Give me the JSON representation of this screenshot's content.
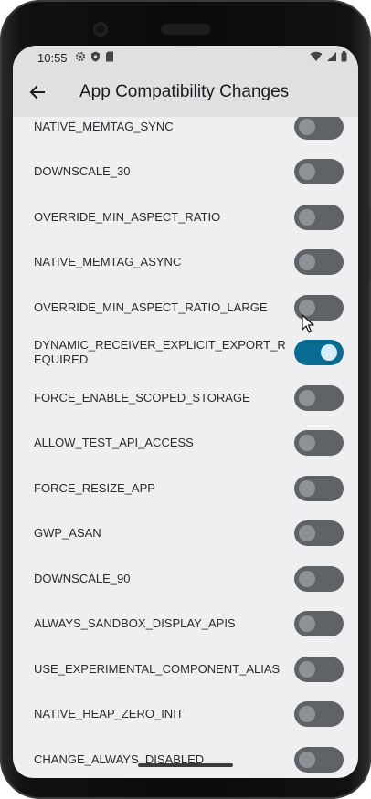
{
  "status": {
    "time": "10:55",
    "left_icons": [
      "gear-icon",
      "shield-icon",
      "sd-card-icon"
    ],
    "right_icons": [
      "wifi-icon",
      "signal-icon",
      "battery-icon"
    ]
  },
  "appbar": {
    "back_icon": "arrow-back-icon",
    "title": "App Compatibility Changes"
  },
  "changes": [
    {
      "label": "NATIVE_MEMTAG_SYNC",
      "enabled": false
    },
    {
      "label": "DOWNSCALE_30",
      "enabled": false
    },
    {
      "label": "OVERRIDE_MIN_ASPECT_RATIO",
      "enabled": false
    },
    {
      "label": "NATIVE_MEMTAG_ASYNC",
      "enabled": false
    },
    {
      "label": "OVERRIDE_MIN_ASPECT_RATIO_LARGE",
      "enabled": false
    },
    {
      "label": "DYNAMIC_RECEIVER_EXPLICIT_EXPORT_REQUIRED",
      "enabled": true
    },
    {
      "label": "FORCE_ENABLE_SCOPED_STORAGE",
      "enabled": false
    },
    {
      "label": "ALLOW_TEST_API_ACCESS",
      "enabled": false
    },
    {
      "label": "FORCE_RESIZE_APP",
      "enabled": false
    },
    {
      "label": "GWP_ASAN",
      "enabled": false
    },
    {
      "label": "DOWNSCALE_90",
      "enabled": false
    },
    {
      "label": "ALWAYS_SANDBOX_DISPLAY_APIS",
      "enabled": false
    },
    {
      "label": "USE_EXPERIMENTAL_COMPONENT_ALIAS",
      "enabled": false
    },
    {
      "label": "NATIVE_HEAP_ZERO_INIT",
      "enabled": false
    },
    {
      "label": "CHANGE_ALWAYS_DISABLED",
      "enabled": false
    }
  ],
  "colors": {
    "toggle_on": "#0a6b92",
    "toggle_off": "#5f6368",
    "background": "#efeff2",
    "appbar": "#e0e0e3"
  }
}
